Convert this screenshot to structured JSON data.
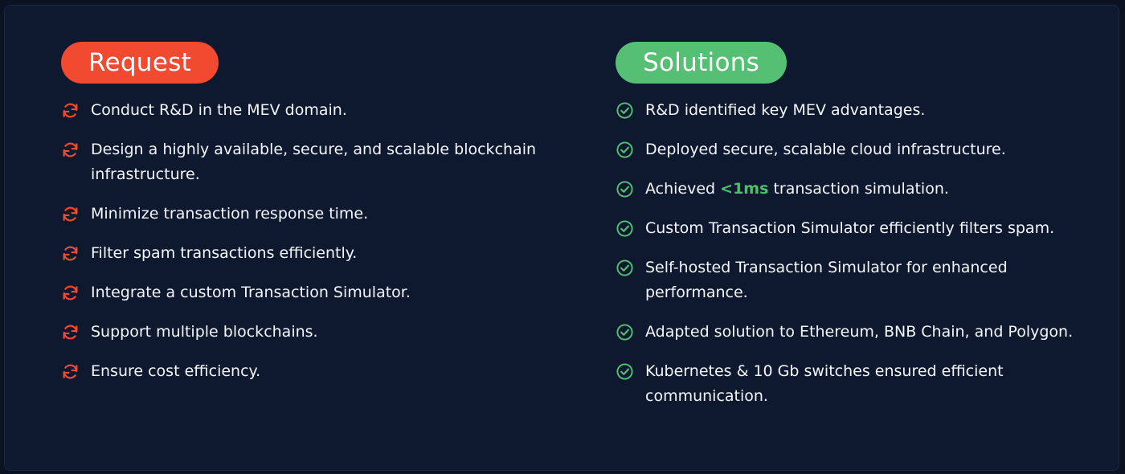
{
  "colors": {
    "background": "#0e1930",
    "request_accent": "#f24a31",
    "solutions_accent": "#55bf73",
    "highlight": "#4fbf6e"
  },
  "request": {
    "title": "Request",
    "icon": "refresh-icon",
    "items": [
      "Conduct R&D in the MEV domain.",
      "Design a highly available, secure, and scalable blockchain infrastructure.",
      "Minimize transaction response time.",
      "Filter spam transactions efficiently.",
      "Integrate a custom Transaction Simulator.",
      "Support multiple blockchains.",
      "Ensure cost efficiency."
    ]
  },
  "solutions": {
    "title": "Solutions",
    "icon": "check-circle-icon",
    "items": [
      {
        "text": "R&D identified key MEV advantages."
      },
      {
        "text": "Deployed secure, scalable cloud infrastructure."
      },
      {
        "pre": "Achieved ",
        "highlight": "<1ms",
        "post": " transaction simulation."
      },
      {
        "text": "Custom Transaction Simulator efficiently filters spam."
      },
      {
        "text": "Self-hosted Transaction Simulator for enhanced performance."
      },
      {
        "text": "Adapted solution to Ethereum, BNB Chain, and Polygon."
      },
      {
        "text": "Kubernetes & 10 Gb switches ensured efficient communication."
      }
    ]
  }
}
